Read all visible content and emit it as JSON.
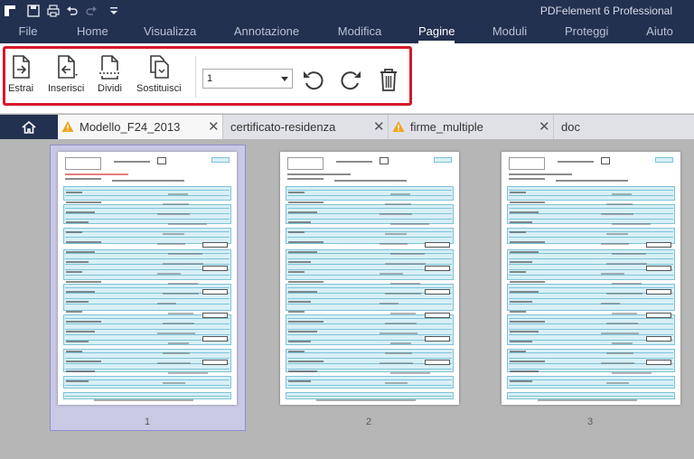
{
  "app": {
    "title": "PDFelement 6 Professional"
  },
  "menu": {
    "items": [
      {
        "label": "File"
      },
      {
        "label": "Home"
      },
      {
        "label": "Visualizza"
      },
      {
        "label": "Annotazione"
      },
      {
        "label": "Modifica"
      },
      {
        "label": "Pagine"
      },
      {
        "label": "Moduli"
      },
      {
        "label": "Proteggi"
      },
      {
        "label": "Aiuto"
      }
    ],
    "active": "Pagine"
  },
  "ribbon": {
    "extract_label": "Estrai",
    "insert_label": "Inserisci",
    "split_label": "Dividi",
    "replace_label": "Sostituisci",
    "page_select_value": "1"
  },
  "tabs": [
    {
      "name": "Modello_F24_2013",
      "warning": true
    },
    {
      "name": "certificato-residenza",
      "warning": false
    },
    {
      "name": "firme_multiple",
      "warning": true
    },
    {
      "name": "doc",
      "warning": false
    }
  ],
  "pages": [
    {
      "number": "1",
      "selected": true
    },
    {
      "number": "2",
      "selected": false
    },
    {
      "number": "3",
      "selected": false
    }
  ],
  "colors": {
    "titlebar": "#223150",
    "highlight": "#d7182a",
    "selection": "#c9c9e4"
  }
}
